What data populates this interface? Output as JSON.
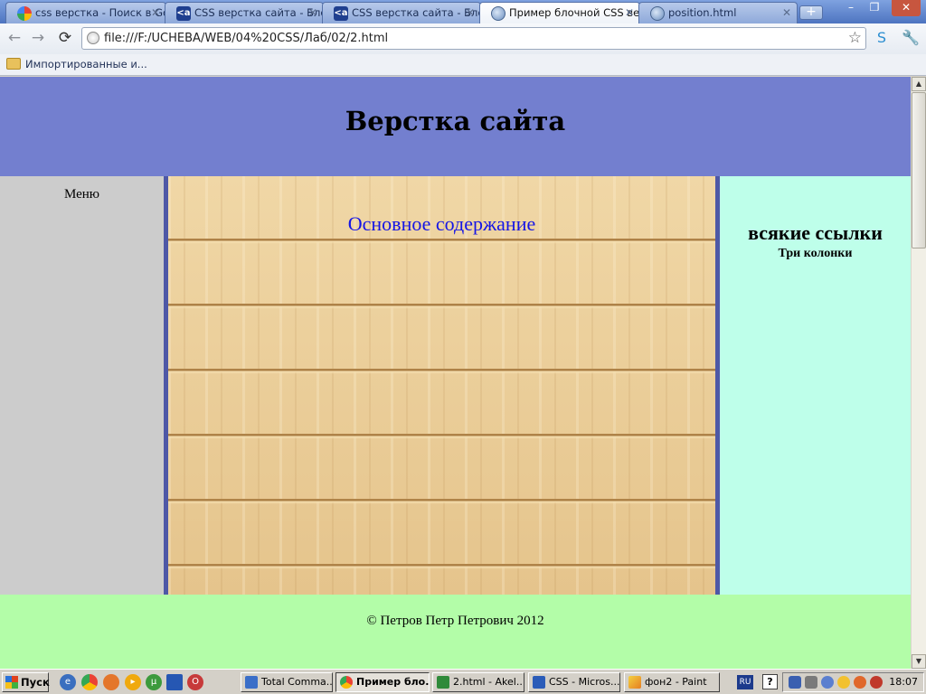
{
  "browser": {
    "tabs": [
      {
        "label": "css верстка - Поиск в Go"
      },
      {
        "label": "CSS верстка сайта - Бло"
      },
      {
        "label": "CSS верстка сайта - Бло"
      },
      {
        "label": "Пример блочной CSS вер",
        "active": true
      },
      {
        "label": "position.html"
      }
    ],
    "new_tab_glyph": "+",
    "window_controls": {
      "minimize": "–",
      "maximize": "❐",
      "close": "✕"
    },
    "address": "file:///F:/UCHEBA/WEB/04%20CSS/Лаб/02/2.html",
    "bookmark_folder": "Импортированные и..."
  },
  "page": {
    "header_title": "Верстка сайта",
    "menu_label": "Меню",
    "content_title": "Основное содержание",
    "links_title": "всякие ссылки",
    "links_subtitle": "Три колонки",
    "footer_text": "© Петров Петр Петрович 2012"
  },
  "taskbar": {
    "start_label": "Пуск",
    "buttons": [
      {
        "label": "Total Comma..."
      },
      {
        "label": "Пример бло...",
        "active": true
      },
      {
        "label": "2.html - Akel..."
      },
      {
        "label": "CSS - Micros..."
      },
      {
        "label": "фон2 - Paint"
      }
    ],
    "language": "RU",
    "help": "?",
    "clock": "18:07"
  },
  "colors": {
    "header_bg": "#737fcf",
    "menu_bg": "#cccccc",
    "content_border": "#4e58a6",
    "links_bg": "#beffea",
    "footer_bg": "#b3fda8",
    "content_title_color": "#1414e6"
  }
}
